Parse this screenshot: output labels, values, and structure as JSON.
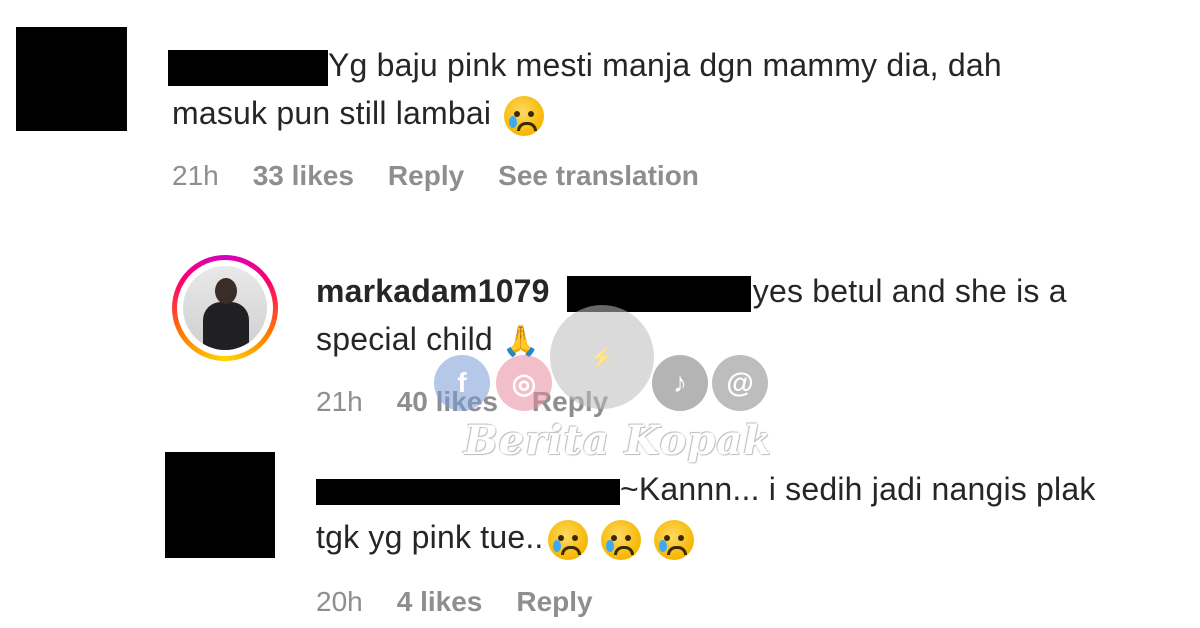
{
  "comments": [
    {
      "text": "Yg baju pink mesti manja dgn mammy dia, dah",
      "text2": "masuk pun still lambai",
      "time": "21h",
      "likes": "33 likes",
      "reply": "Reply",
      "translate": "See translation"
    },
    {
      "username": "markadam1079",
      "text": "yes betul and she is a",
      "text2": "special child",
      "time": "21h",
      "likes": "40 likes",
      "reply": "Reply"
    },
    {
      "text": "~Kannn... i sedih jadi nangis plak",
      "text2": "tgk yg pink tue..",
      "time": "20h",
      "likes": "4 likes",
      "reply": "Reply"
    }
  ],
  "watermark": {
    "brand": "Berita Kopak",
    "icons": [
      "facebook-icon",
      "instagram-icon",
      "logo-icon",
      "tiktok-icon",
      "threads-icon"
    ]
  },
  "colors": {
    "text": "#262626",
    "meta": "#8e8e8e",
    "redaction": "#000000"
  }
}
